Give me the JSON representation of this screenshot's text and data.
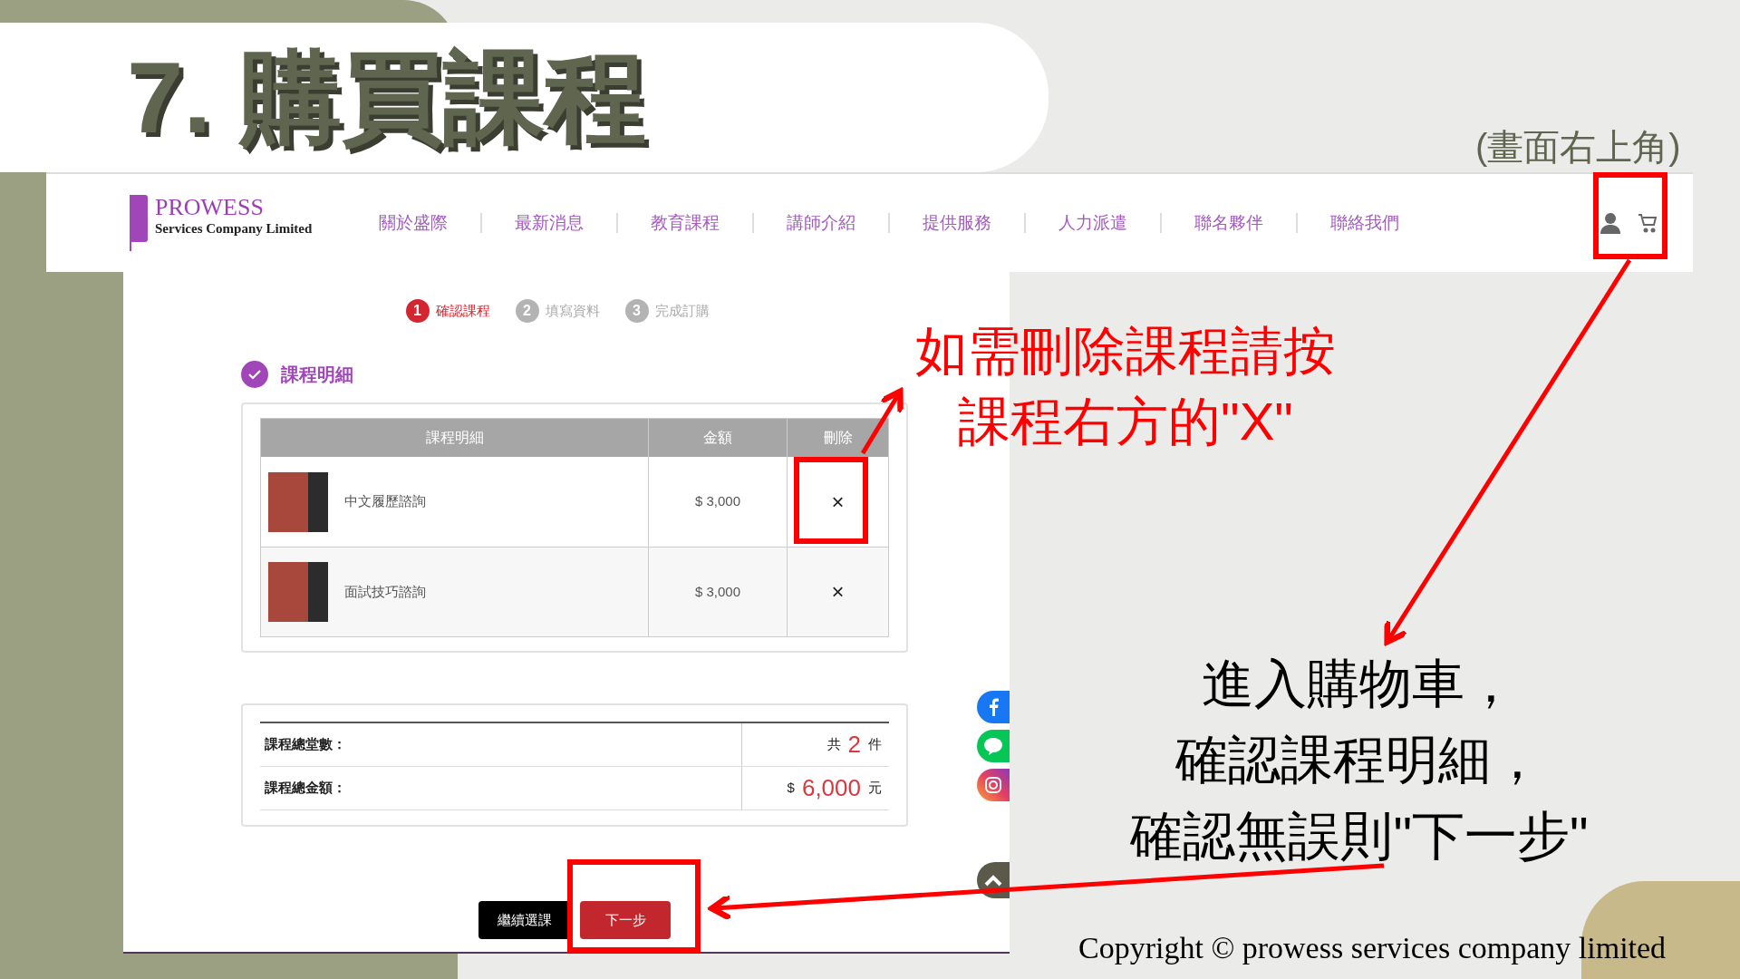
{
  "slide": {
    "title": "7. 購買課程",
    "note": "(畫面右上角)",
    "callouts": [
      "如需刪除課程請按",
      "課程右方的\"X\""
    ],
    "instructions": [
      "進入購物車，",
      "確認課程明細，",
      "確認無誤則\"下一步\""
    ],
    "copyright": "Copyright © prowess services company limited"
  },
  "site": {
    "logo": {
      "name": "PROWESS",
      "tagline": "Services Company Limited"
    },
    "nav": [
      "關於盛際",
      "最新消息",
      "教育課程",
      "講師介紹",
      "提供服務",
      "人力派遣",
      "聯名夥伴",
      "聯絡我們"
    ],
    "steps": [
      {
        "number": "1",
        "label": "確認課程",
        "selected": true
      },
      {
        "number": "2",
        "label": "填寫資料",
        "selected": false
      },
      {
        "number": "3",
        "label": "完成訂購",
        "selected": false
      }
    ],
    "section_title": "課程明細",
    "cart": {
      "columns": [
        "課程明細",
        "金額",
        "刪除"
      ],
      "rows": [
        {
          "name": "中文履歷諮詢",
          "price": "$ 3,000",
          "delete": "×"
        },
        {
          "name": "面試技巧諮詢",
          "price": "$ 3,000",
          "delete": "×"
        }
      ]
    },
    "summary": [
      {
        "label": "課程總堂數：",
        "prefix": "共",
        "value": "2",
        "suffix": "件"
      },
      {
        "label": "課程總金額：",
        "prefix": "$",
        "value": "6,000",
        "suffix": "元"
      }
    ],
    "buttons": [
      {
        "label": "繼續選課",
        "kind": "secondary"
      },
      {
        "label": "下一步",
        "kind": "primary"
      }
    ]
  }
}
